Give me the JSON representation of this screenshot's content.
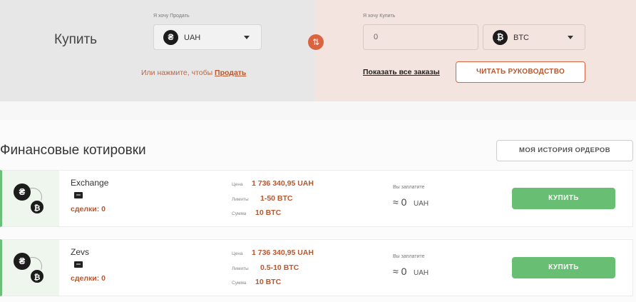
{
  "exchange_form": {
    "title": "Купить",
    "sell_label": "Я хочу Продать",
    "sell_currency": {
      "code": "UAH",
      "icon": "hryvnia-icon",
      "glyph": "₴"
    },
    "buy_label": "Я хочу Купить",
    "buy_amount": "0",
    "buy_currency": {
      "code": "BTC",
      "icon": "bitcoin-icon",
      "glyph": "₿"
    },
    "swap_glyph": "⇅",
    "or_text": "Или нажмите, чтобы ",
    "sell_link": "Продать",
    "all_orders_link": "Показать все заказы",
    "guide_button": "ЧИТАТЬ РУКОВОДСТВО"
  },
  "quotes": {
    "title": "Финансовые котировки",
    "history_button": "МОЯ ИСТОРИЯ ОРДЕРОВ",
    "price_label": "Цена",
    "limits_label": "Лимиты",
    "sum_label": "Сумма",
    "pay_label": "Вы заплатите",
    "buy_button": "КУПИТЬ",
    "orders": [
      {
        "trader": "Exchange",
        "deals": "сделки: 0",
        "price": "1 736 340,95 UAH",
        "limits": "1-50 BTC",
        "sum": "10 BTC",
        "pay_amount": "≈ 0",
        "pay_currency": "UAH"
      },
      {
        "trader": "Zevs",
        "deals": "сделки: 0",
        "price": "1 736 340,95 UAH",
        "limits": "0.5-10 BTC",
        "sum": "10 BTC",
        "pay_amount": "≈ 0",
        "pay_currency": "UAH"
      }
    ]
  },
  "colors": {
    "accent_orange": "#d9643f",
    "buy_green": "#68bf73",
    "value_brown": "#b9572e"
  }
}
